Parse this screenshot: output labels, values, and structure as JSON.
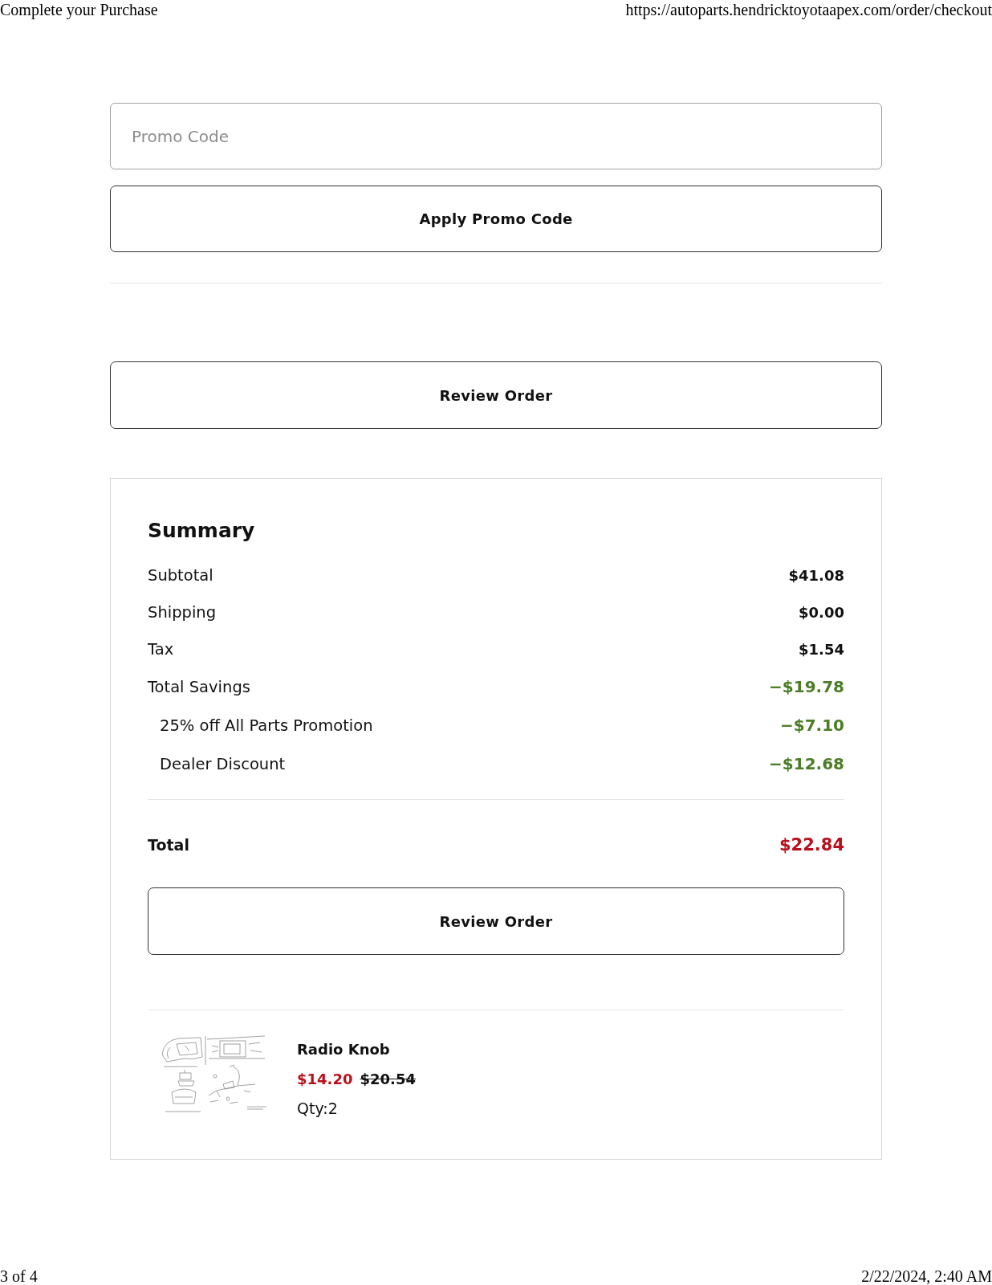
{
  "page_header": {
    "title": "Complete your Purchase",
    "url": "https://autoparts.hendricktoyotaapex.com/order/checkout"
  },
  "promo": {
    "placeholder": "Promo Code",
    "apply_button": "Apply Promo Code"
  },
  "review_button": "Review Order",
  "summary": {
    "title": "Summary",
    "rows": [
      {
        "kind": "charge",
        "label": "Subtotal",
        "value": "$41.08"
      },
      {
        "kind": "charge",
        "label": "Shipping",
        "value": "$0.00"
      },
      {
        "kind": "charge",
        "label": "Tax",
        "value": "$1.54"
      },
      {
        "kind": "savings",
        "label": "Total Savings",
        "value": "−$19.78"
      },
      {
        "kind": "discount",
        "label": "25% off All Parts Promotion",
        "value": "−$7.10"
      },
      {
        "kind": "discount",
        "label": "Dealer Discount",
        "value": "−$12.68"
      }
    ],
    "total": {
      "label": "Total",
      "value": "$22.84"
    },
    "review_button": "Review Order",
    "items": [
      {
        "name": "Radio Knob",
        "price": "$14.20",
        "original_price": "$20.54",
        "quantity": "Qty:2"
      }
    ]
  },
  "page_footer": {
    "page": "3 of 4",
    "printed": "2/22/2024, 2:40 AM"
  }
}
